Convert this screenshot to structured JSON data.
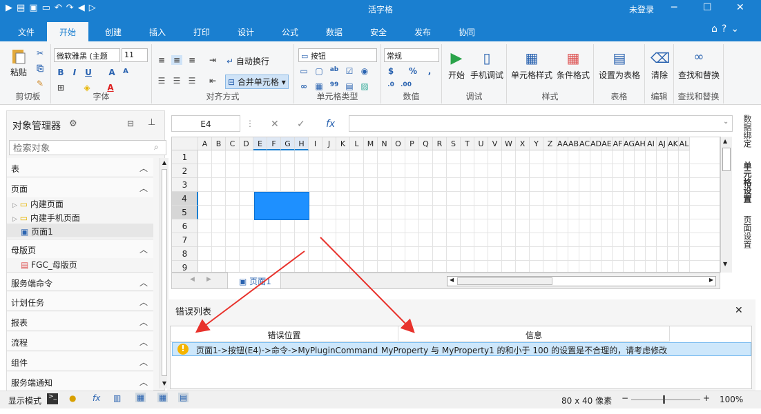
{
  "app": {
    "title": "活字格",
    "user": "未登录"
  },
  "tabs": [
    "文件",
    "开始",
    "创建",
    "插入",
    "打印",
    "设计",
    "公式",
    "数据",
    "安全",
    "发布",
    "协同"
  ],
  "ribbon": {
    "clipboard": {
      "paste": "粘贴",
      "label": "剪切板"
    },
    "font": {
      "name": "微软雅黑 (主题",
      "size": "11",
      "label": "字体"
    },
    "align": {
      "wrap": "自动换行",
      "merge": "合并单元格",
      "label": "对齐方式"
    },
    "celltype": {
      "value": "按钮",
      "label": "单元格类型"
    },
    "number": {
      "value": "常规",
      "label": "数值"
    },
    "debug": {
      "start": "开始",
      "mobile": "手机调试",
      "label": "调试"
    },
    "style": {
      "cellstyle": "单元格样式",
      "cond": "条件格式",
      "label": "样式"
    },
    "table": {
      "set": "设置为表格",
      "label": "表格"
    },
    "edit": {
      "clear": "清除",
      "label": "编辑"
    },
    "find": {
      "btn": "查找和替换",
      "label": "查找和替换"
    }
  },
  "objmgr": {
    "title": "对象管理器",
    "search_placeholder": "检索对象",
    "sec_table": "表",
    "sec_page": "页面",
    "nodes": [
      "内建页面",
      "内建手机页面",
      "页面1"
    ],
    "sec_master": "母版页",
    "master_node": "FGC_母版页",
    "sections": [
      "服务端命令",
      "计划任务",
      "报表",
      "流程",
      "组件",
      "服务端通知"
    ]
  },
  "formula": {
    "cell": "E4",
    "fx": "fx"
  },
  "grid": {
    "cols": [
      "A",
      "B",
      "C",
      "D",
      "E",
      "F",
      "G",
      "H",
      "I",
      "J",
      "K",
      "L",
      "M",
      "N",
      "O",
      "P",
      "Q",
      "R",
      "S",
      "T",
      "U",
      "V",
      "W",
      "X",
      "Y",
      "Z",
      "AA",
      "AB",
      "AC",
      "AD",
      "AE",
      "AF",
      "AG",
      "AH",
      "AI",
      "AJ",
      "AK",
      "AL"
    ],
    "rows": [
      "1",
      "2",
      "3",
      "4",
      "5",
      "6",
      "7",
      "8",
      "9"
    ],
    "sheet": "页面1"
  },
  "rightpanel": [
    "数据绑定",
    "单元格设置",
    "页面设置"
  ],
  "errors": {
    "title": "错误列表",
    "col_loc": "错误位置",
    "col_info": "信息",
    "rows": [
      {
        "loc": "页面1->按钮(E4)->命令->MyPluginCommand",
        "info": "MyProperty 与 MyProperty1 的和小于 100 的设置是不合理的，请考虑修改"
      }
    ]
  },
  "status": {
    "mode": "显示模式",
    "size": "80 x 40 像素",
    "zoom": "100%"
  },
  "colors": {
    "accent": "#1a7fd0",
    "arrow": "#e8322c",
    "selection": "#1e90ff"
  }
}
